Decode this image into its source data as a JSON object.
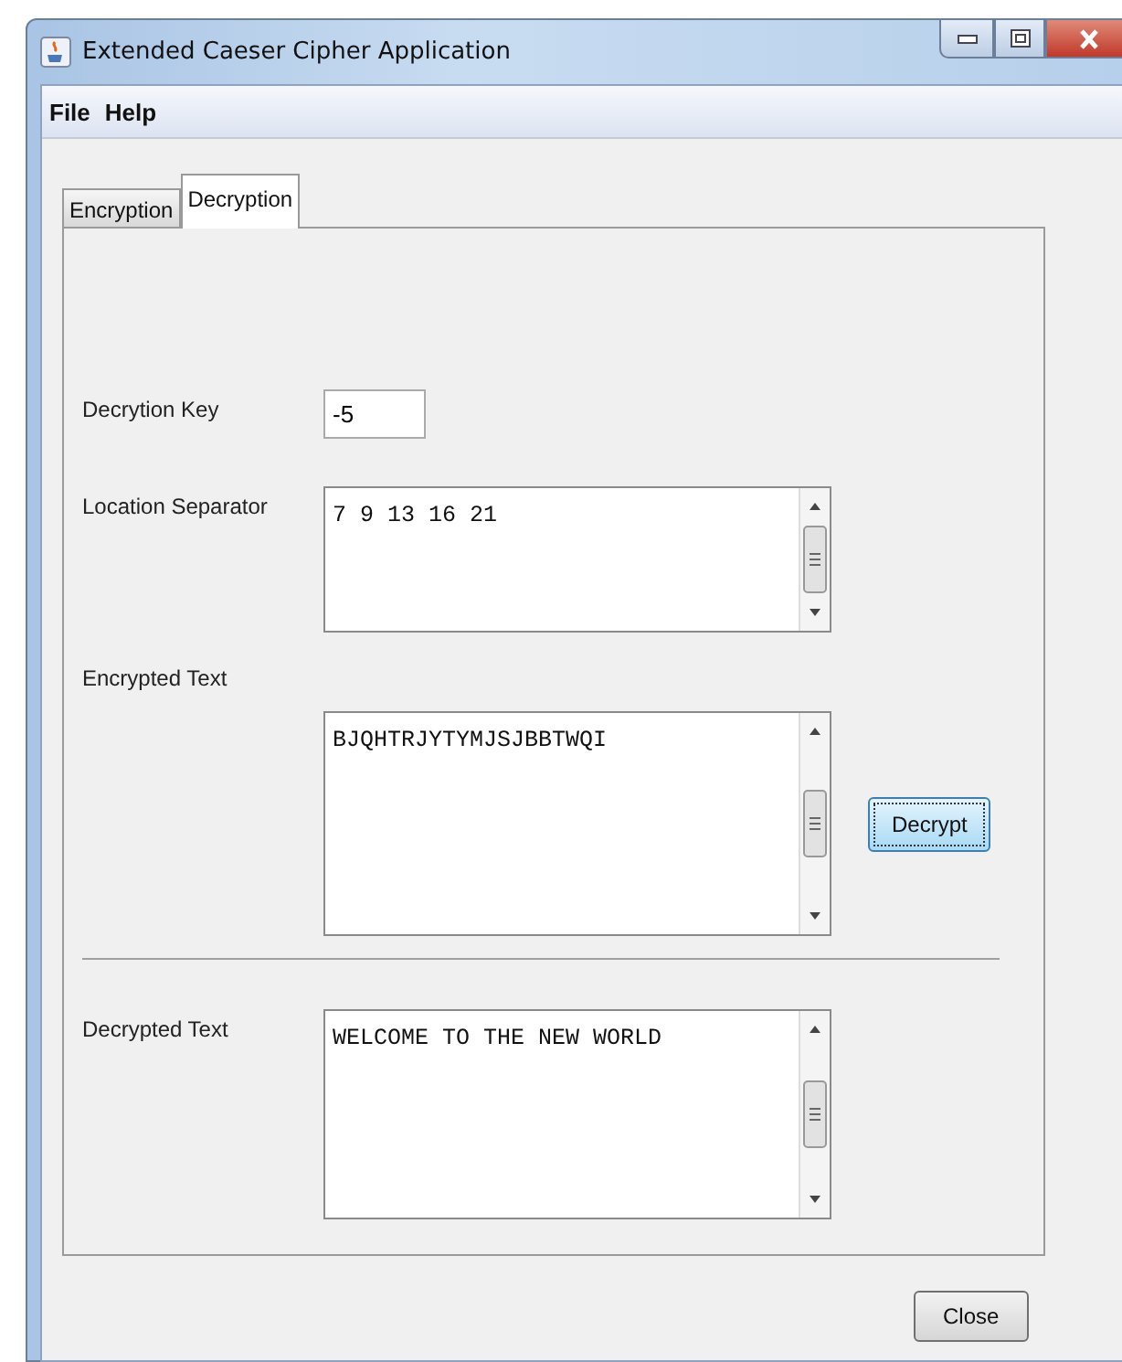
{
  "window": {
    "title": "Extended Caeser Cipher Application"
  },
  "menu": [
    "File",
    "Help"
  ],
  "tabs": [
    {
      "label": "Encryption",
      "selected": false
    },
    {
      "label": "Decryption",
      "selected": true
    }
  ],
  "key": {
    "label": "Decrytion Key",
    "value": "-5"
  },
  "location": {
    "label": "Location Separator",
    "value": "7 9 13 16 21"
  },
  "encrypted": {
    "label": "Encrypted Text",
    "value": "BJQHTRJYTYMJSJBBTWQI"
  },
  "decrypt_button": "Decrypt",
  "decrypted": {
    "label": "Decrypted Text",
    "value": "WELCOME TO THE NEW WORLD"
  },
  "close_button": "Close"
}
